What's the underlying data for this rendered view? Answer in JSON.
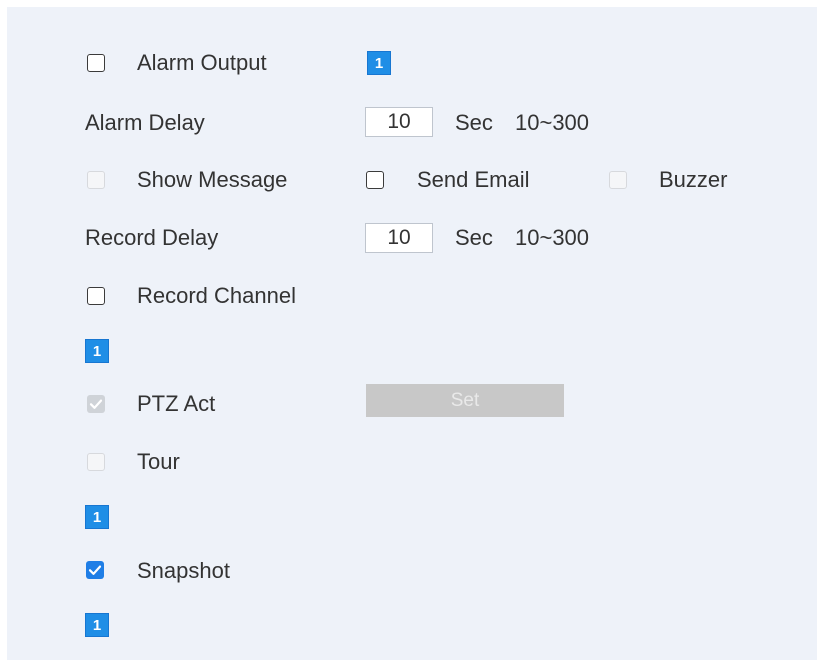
{
  "alarm_output": {
    "label": "Alarm Output",
    "channel": "1"
  },
  "alarm_delay": {
    "label": "Alarm Delay",
    "value": "10",
    "unit": "Sec",
    "range": "10~300"
  },
  "notifications": {
    "show_message_label": "Show Message",
    "send_email_label": "Send Email",
    "buzzer_label": "Buzzer"
  },
  "record_delay": {
    "label": "Record Delay",
    "value": "10",
    "unit": "Sec",
    "range": "10~300"
  },
  "record_channel": {
    "label": "Record Channel",
    "channel": "1"
  },
  "ptz_act": {
    "label": "PTZ Act",
    "set_label": "Set"
  },
  "tour": {
    "label": "Tour",
    "channel": "1"
  },
  "snapshot": {
    "label": "Snapshot",
    "channel": "1"
  },
  "colors": {
    "panel_bg": "#eef2f9",
    "accent": "#1f8ee6",
    "disabled_button": "#c8c8c8"
  }
}
